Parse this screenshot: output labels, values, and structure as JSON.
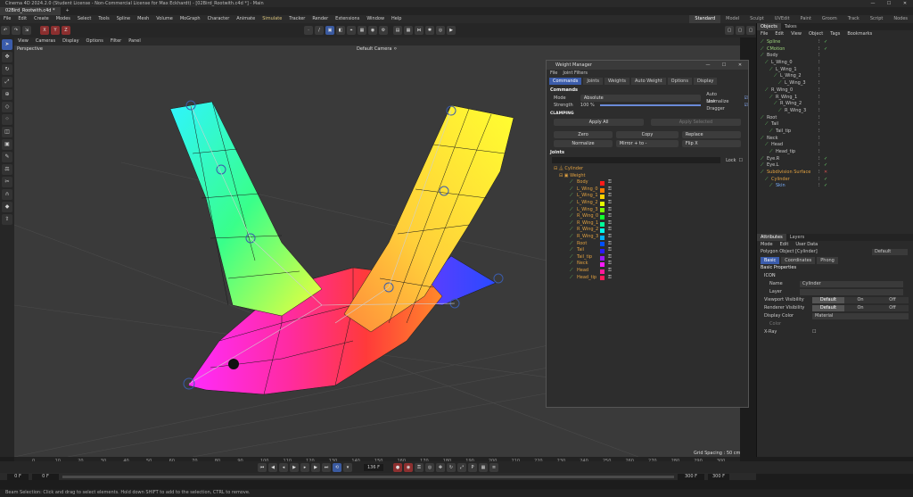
{
  "app": {
    "window_title": "Cinema 4D 2024.2.0 (Student License - Non-Commercial License for Max Eckhardt) - [02Bird_Rootwith.c4d *] - Main",
    "doc_tabs": [
      "02Bird_Rootwith.c4d *",
      "+"
    ],
    "window_controls": [
      "—",
      "☐",
      "✕"
    ]
  },
  "menu": {
    "items": [
      "File",
      "Edit",
      "Create",
      "Modes",
      "Select",
      "Tools",
      "Spline",
      "Mesh",
      "Volume",
      "MoGraph",
      "Character",
      "Animate",
      "Simulate",
      "Tracker",
      "Render",
      "Extensions",
      "Window",
      "Help"
    ],
    "accent_item": "Simulate",
    "layouts": [
      "Standard",
      "Model",
      "Sculpt",
      "UVEdit",
      "Paint",
      "Groom",
      "Track",
      "Script",
      "Nodes"
    ],
    "active_layout": "Standard"
  },
  "toolbar": {
    "axis_labels": [
      "X",
      "Y",
      "Z"
    ],
    "left_buttons": [
      "↶",
      "↷",
      "⇲"
    ]
  },
  "viewport": {
    "menu": [
      "View",
      "Cameras",
      "Display",
      "Options",
      "Filter",
      "Panel"
    ],
    "name": "Perspective",
    "camera": "Default Camera ⚪",
    "grid_spacing": "Grid Spacing : 50 cm"
  },
  "weight_manager": {
    "title": "Weight Manager",
    "window_controls": [
      "—",
      "☐",
      "✕"
    ],
    "menu": [
      "File",
      "Joint Filters"
    ],
    "tabs": [
      "Commands",
      "Joints",
      "Weights",
      "Auto Weight",
      "Options",
      "Display"
    ],
    "active_tab": "Commands",
    "commands_header": "Commands",
    "mode_label": "Mode",
    "mode_value": "Absolute",
    "strength_label": "Strength",
    "strength_value": "100 %",
    "auto_normalize_label": "Auto Normalize",
    "link_dragger_label": "Link Dragger",
    "clamping_label": "CLAMPING",
    "apply_all": "Apply All",
    "apply_selected": "Apply Selected",
    "zero": "Zero",
    "copy": "Copy",
    "replace": "Replace",
    "normalize": "Normalize",
    "mirror": "Mirror + to -",
    "flip": "Flip X",
    "joints_header": "Joints",
    "lock_label": "Lock",
    "tree_root": "Cylinder",
    "tree_group": "Weight",
    "joints": [
      {
        "name": "Body",
        "color": "#ff1a1a"
      },
      {
        "name": "L_Wing_0",
        "color": "#ff7a00"
      },
      {
        "name": "L_Wing_1",
        "color": "#ffd200"
      },
      {
        "name": "L_Wing_2",
        "color": "#e6ff00"
      },
      {
        "name": "L_Wing_3",
        "color": "#7aff00"
      },
      {
        "name": "R_Wing_0",
        "color": "#10ff30"
      },
      {
        "name": "R_Wing_1",
        "color": "#00ff9a"
      },
      {
        "name": "R_Wing_2",
        "color": "#00ffee"
      },
      {
        "name": "R_Wing_3",
        "color": "#00b4ff"
      },
      {
        "name": "Root",
        "color": "#0050ff"
      },
      {
        "name": "Tail",
        "color": "#2a1aff"
      },
      {
        "name": "Tail_tip",
        "color": "#9a1aff"
      },
      {
        "name": "Neck",
        "color": "#ff1aff"
      },
      {
        "name": "Head",
        "color": "#ff1a9a"
      },
      {
        "name": "Head_tip",
        "color": "#ff1a5a"
      }
    ]
  },
  "objects_panel": {
    "tabs": [
      "Objects",
      "Takes"
    ],
    "menu": [
      "File",
      "Edit",
      "View",
      "Object",
      "Tags",
      "Bookmarks"
    ],
    "items": [
      {
        "name": "Spline",
        "depth": 0,
        "color": "#9ad07a",
        "check": "✓"
      },
      {
        "name": "CMotion",
        "depth": 0,
        "color": "#9ad07a",
        "check": "✓"
      },
      {
        "name": "Body",
        "depth": 0,
        "color": "#c8c8c8",
        "check": ""
      },
      {
        "name": "L_Wing_0",
        "depth": 1,
        "color": "#c8c8c8",
        "check": ""
      },
      {
        "name": "L_Wing_1",
        "depth": 2,
        "color": "#c8c8c8",
        "check": ""
      },
      {
        "name": "L_Wing_2",
        "depth": 3,
        "color": "#c8c8c8",
        "check": ""
      },
      {
        "name": "L_Wing_3",
        "depth": 4,
        "color": "#c8c8c8",
        "check": ""
      },
      {
        "name": "R_Wing_0",
        "depth": 1,
        "color": "#c8c8c8",
        "check": ""
      },
      {
        "name": "R_Wing_1",
        "depth": 2,
        "color": "#c8c8c8",
        "check": ""
      },
      {
        "name": "R_Wing_2",
        "depth": 3,
        "color": "#c8c8c8",
        "check": ""
      },
      {
        "name": "R_Wing_3",
        "depth": 4,
        "color": "#c8c8c8",
        "check": ""
      },
      {
        "name": "Root",
        "depth": 0,
        "color": "#c8c8c8",
        "check": ""
      },
      {
        "name": "Tail",
        "depth": 1,
        "color": "#c8c8c8",
        "check": ""
      },
      {
        "name": "Tail_tip",
        "depth": 2,
        "color": "#c8c8c8",
        "check": ""
      },
      {
        "name": "Neck",
        "depth": 0,
        "color": "#c8c8c8",
        "check": ""
      },
      {
        "name": "Head",
        "depth": 1,
        "color": "#c8c8c8",
        "check": ""
      },
      {
        "name": "Head_tip",
        "depth": 2,
        "color": "#c8c8c8",
        "check": ""
      },
      {
        "name": "Eye.R",
        "depth": 0,
        "color": "#c8c8c8",
        "check": "✓"
      },
      {
        "name": "Eye.L",
        "depth": 0,
        "color": "#c8c8c8",
        "check": "✓"
      },
      {
        "name": "Subdivision Surface",
        "depth": 0,
        "color": "#e0a040",
        "check": "✕"
      },
      {
        "name": "Cylinder",
        "depth": 1,
        "color": "#e0a040",
        "check": "✓"
      },
      {
        "name": "Skin",
        "depth": 2,
        "color": "#7ab0ff",
        "check": "✓"
      }
    ]
  },
  "attributes": {
    "tabs": [
      "Attributes",
      "Layers"
    ],
    "menu": [
      "Mode",
      "Edit",
      "User Data"
    ],
    "object_type": "Polygon Object [Cylinder]",
    "preset": "Default",
    "sub_tabs": [
      "Basic",
      "Coordinates",
      "Phong"
    ],
    "active_sub_tab": "Basic",
    "section": "Basic Properties",
    "subsection": "ICON",
    "name_label": "Name",
    "name_value": "Cylinder",
    "layer_label": "Layer",
    "viewport_vis_label": "Viewport Visibility",
    "render_vis_label": "Renderer Visibility",
    "vis_options": [
      "Default",
      "On",
      "Off"
    ],
    "display_color_label": "Display Color",
    "display_color_value": "Material",
    "color_label": "Color",
    "xray_label": "X-Ray"
  },
  "timeline": {
    "ticks": [
      "0",
      "10",
      "20",
      "30",
      "40",
      "50",
      "60",
      "70",
      "80",
      "90",
      "100",
      "110",
      "120",
      "130",
      "140",
      "150",
      "160",
      "170",
      "180",
      "190",
      "200",
      "210",
      "220",
      "230",
      "240",
      "250",
      "260",
      "270",
      "280",
      "290",
      "300"
    ],
    "current_frame": "136 F",
    "start_a": "0 F",
    "start_b": "0 F",
    "end_a": "300 F",
    "end_b": "300 F"
  },
  "status": {
    "text": "Beam Selection: Click and drag to select elements. Hold down SHIFT to add to the selection, CTRL to remove."
  },
  "colors": {
    "accent": "#3b5cab",
    "panel": "#2a2a2a",
    "viewport": "#3a3a3a"
  }
}
